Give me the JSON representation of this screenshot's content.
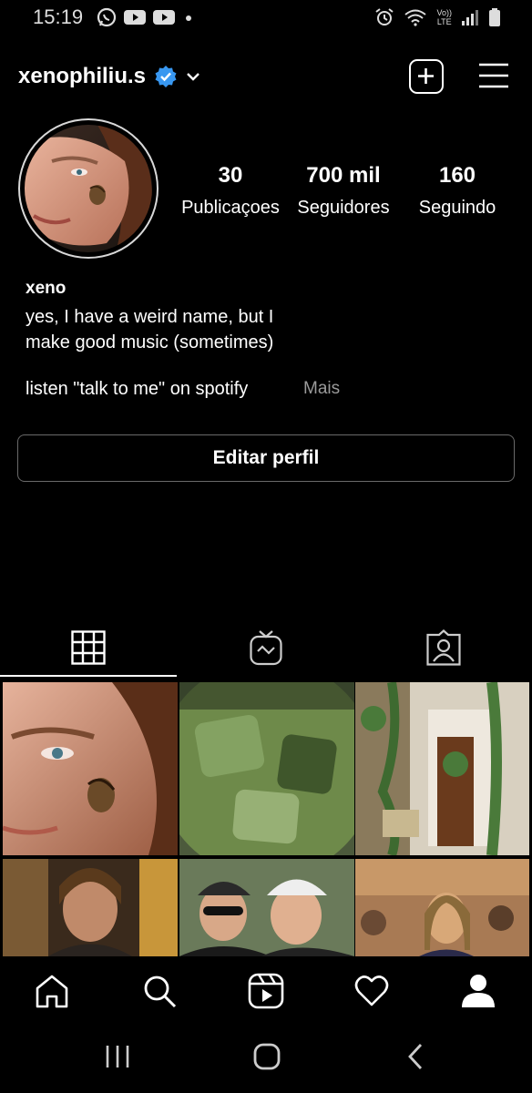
{
  "status_bar": {
    "time": "15:19",
    "left_icons": [
      "whatsapp-icon",
      "youtube-icon",
      "youtube-icon",
      "dot"
    ],
    "right_icons": [
      "alarm-icon",
      "wifi-icon",
      "volte-icon",
      "signal-icon",
      "battery-icon"
    ],
    "volte_top": "Vo))",
    "volte_bottom": "LTE"
  },
  "header": {
    "username": "xenophiliu.s",
    "verified": true,
    "accent_color": "#3897f0"
  },
  "profile": {
    "stats": [
      {
        "value": "30",
        "label": "Publicaçoes"
      },
      {
        "value": "700 mil",
        "label": "Seguidores"
      },
      {
        "value": "160",
        "label": "Seguindo"
      }
    ],
    "bio": {
      "name": "xeno",
      "line1": "yes, I have a weird name, but I",
      "line2": "make good music (sometimes)",
      "link_line": "listen \"talk to me\" on spotify",
      "more": "Mais"
    },
    "edit_button": "Editar perfil"
  },
  "tabs": [
    {
      "icon": "grid-icon",
      "active": true
    },
    {
      "icon": "igtv-icon",
      "active": false
    },
    {
      "icon": "tagged-icon",
      "active": false
    }
  ],
  "grid_posts": [
    "selfie-with-snail-photo",
    "matcha-iced-drink-photo",
    "plant-filled-hallway-photo",
    "smiling-man-indoors-photo",
    "two-friends-in-caps-photo",
    "street-crowd-photo"
  ],
  "bottom_nav": [
    "home-icon",
    "search-icon",
    "reels-icon",
    "heart-icon",
    "profile-icon"
  ],
  "system_nav": [
    "recents-icon",
    "home-circle-icon",
    "back-icon"
  ]
}
